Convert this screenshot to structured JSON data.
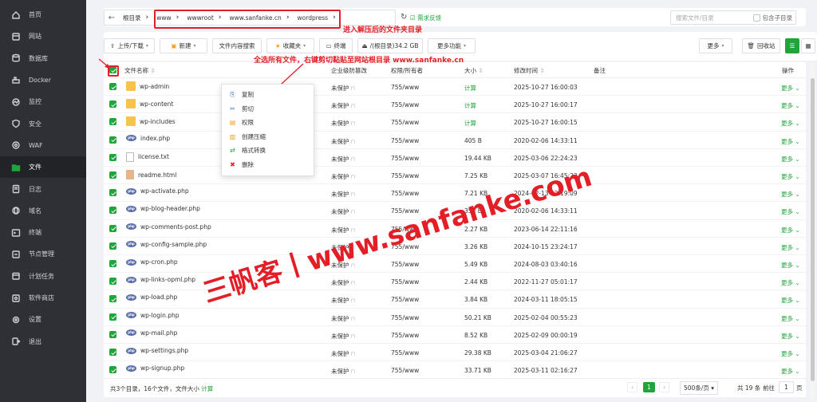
{
  "sidebar": {
    "items": [
      {
        "label": "首页",
        "icon": "home-icon"
      },
      {
        "label": "网站",
        "icon": "globe-icon"
      },
      {
        "label": "数据库",
        "icon": "database-icon"
      },
      {
        "label": "Docker",
        "icon": "docker-icon"
      },
      {
        "label": "监控",
        "icon": "monitor-icon"
      },
      {
        "label": "安全",
        "icon": "shield-icon"
      },
      {
        "label": "WAF",
        "icon": "waf-icon"
      },
      {
        "label": "文件",
        "icon": "folder-icon"
      },
      {
        "label": "日志",
        "icon": "log-icon"
      },
      {
        "label": "域名",
        "icon": "domain-icon"
      },
      {
        "label": "终端",
        "icon": "terminal-icon"
      },
      {
        "label": "节点管理",
        "icon": "node-icon"
      },
      {
        "label": "计划任务",
        "icon": "clock-icon"
      },
      {
        "label": "软件商店",
        "icon": "store-icon"
      },
      {
        "label": "设置",
        "icon": "gear-icon"
      },
      {
        "label": "退出",
        "icon": "logout-icon"
      }
    ],
    "active": "文件"
  },
  "path": {
    "root": "根目录",
    "segments": [
      "www",
      "wwwroot",
      "www.sanfanke.cn",
      "wordpress"
    ]
  },
  "topbar": {
    "feedback": "需求反馈",
    "search_placeholder": "搜索文件/目录",
    "include_sub": "包含子目录"
  },
  "toolbar": {
    "upload": "上传/下载",
    "new": "新建",
    "content_search": "文件内容搜索",
    "favorites": "收藏夹",
    "terminal": "终端",
    "disk": "/(根目录)34.2 GB",
    "more_functions": "更多功能",
    "more": "更多",
    "recycle": "回收站"
  },
  "table": {
    "headers": {
      "name": "文件名称",
      "protect": "企业级防篡改",
      "perm": "权限/所有者",
      "size": "大小",
      "mtime": "修改时间",
      "note": "备注",
      "ops": "操作"
    },
    "rows": [
      {
        "name": "wp-admin",
        "type": "folder",
        "protect": "未保护",
        "perm": "755/www",
        "size": "计算",
        "mtime": "2025-10-27 16:00:03"
      },
      {
        "name": "wp-content",
        "type": "folder",
        "protect": "未保护",
        "perm": "755/www",
        "size": "计算",
        "mtime": "2025-10-27 16:00:17"
      },
      {
        "name": "wp-includes",
        "type": "folder",
        "protect": "未保护",
        "perm": "755/www",
        "size": "计算",
        "mtime": "2025-10-27 16:00:15"
      },
      {
        "name": "index.php",
        "type": "php",
        "protect": "未保护",
        "perm": "755/www",
        "size": "405 B",
        "mtime": "2020-02-06 14:33:11"
      },
      {
        "name": "license.txt",
        "type": "txt",
        "protect": "未保护",
        "perm": "755/www",
        "size": "19.44 KB",
        "mtime": "2025-03-06 22:24:23"
      },
      {
        "name": "readme.html",
        "type": "html",
        "protect": "未保护",
        "perm": "755/www",
        "size": "7.25 KB",
        "mtime": "2025-03-07 16:45:23"
      },
      {
        "name": "wp-activate.php",
        "type": "php",
        "protect": "未保护",
        "perm": "755/www",
        "size": "7.21 KB",
        "mtime": "2024-02-13 22:19:09"
      },
      {
        "name": "wp-blog-header.php",
        "type": "php",
        "protect": "未保护",
        "perm": "755/www",
        "size": "351 B",
        "mtime": "2020-02-06 14:33:11"
      },
      {
        "name": "wp-comments-post.php",
        "type": "php",
        "protect": "未保护",
        "perm": "755/www",
        "size": "2.27 KB",
        "mtime": "2023-06-14 22:11:16"
      },
      {
        "name": "wp-config-sample.php",
        "type": "php",
        "protect": "未保护",
        "perm": "755/www",
        "size": "3.26 KB",
        "mtime": "2024-10-15 23:24:17"
      },
      {
        "name": "wp-cron.php",
        "type": "php",
        "protect": "未保护",
        "perm": "755/www",
        "size": "5.49 KB",
        "mtime": "2024-08-03 03:40:16"
      },
      {
        "name": "wp-links-opml.php",
        "type": "php",
        "protect": "未保护",
        "perm": "755/www",
        "size": "2.44 KB",
        "mtime": "2022-11-27 05:01:17"
      },
      {
        "name": "wp-load.php",
        "type": "php",
        "protect": "未保护",
        "perm": "755/www",
        "size": "3.84 KB",
        "mtime": "2024-03-11 18:05:15"
      },
      {
        "name": "wp-login.php",
        "type": "php",
        "protect": "未保护",
        "perm": "755/www",
        "size": "50.21 KB",
        "mtime": "2025-02-04 00:55:23"
      },
      {
        "name": "wp-mail.php",
        "type": "php",
        "protect": "未保护",
        "perm": "755/www",
        "size": "8.52 KB",
        "mtime": "2025-02-09 00:00:19"
      },
      {
        "name": "wp-settings.php",
        "type": "php",
        "protect": "未保护",
        "perm": "755/www",
        "size": "29.38 KB",
        "mtime": "2025-03-04 21:06:27"
      },
      {
        "name": "wp-signup.php",
        "type": "php",
        "protect": "未保护",
        "perm": "755/www",
        "size": "33.71 KB",
        "mtime": "2025-03-11 02:16:27"
      }
    ],
    "row_more": "更多"
  },
  "context_menu": [
    {
      "label": "复制",
      "icon": "copy-icon"
    },
    {
      "label": "剪切",
      "icon": "scissors-icon"
    },
    {
      "label": "权限",
      "icon": "permission-icon"
    },
    {
      "label": "创建压缩",
      "icon": "compress-icon"
    },
    {
      "label": "格式转换",
      "icon": "convert-icon"
    },
    {
      "label": "删除",
      "icon": "delete-icon"
    }
  ],
  "annotations": {
    "path_note": "进入解压后的文件夹目录",
    "select_note": "全选所有文件，右键剪切黏贴至网站根目录 www.sanfanke.cn"
  },
  "watermark": {
    "main": "三帆客丨www.sanfanke.com"
  },
  "footer": {
    "summary": "共3个目录，16个文件，文件大小",
    "calc": "计算",
    "page_current": "1",
    "page_size": "500条/页",
    "total": "共 19 条",
    "goto": "前往",
    "goto_value": "1",
    "page_suffix": "页"
  },
  "colors": {
    "accent": "#20a53a",
    "annotation": "#e41e26",
    "sidebar_bg": "#2e3036"
  }
}
